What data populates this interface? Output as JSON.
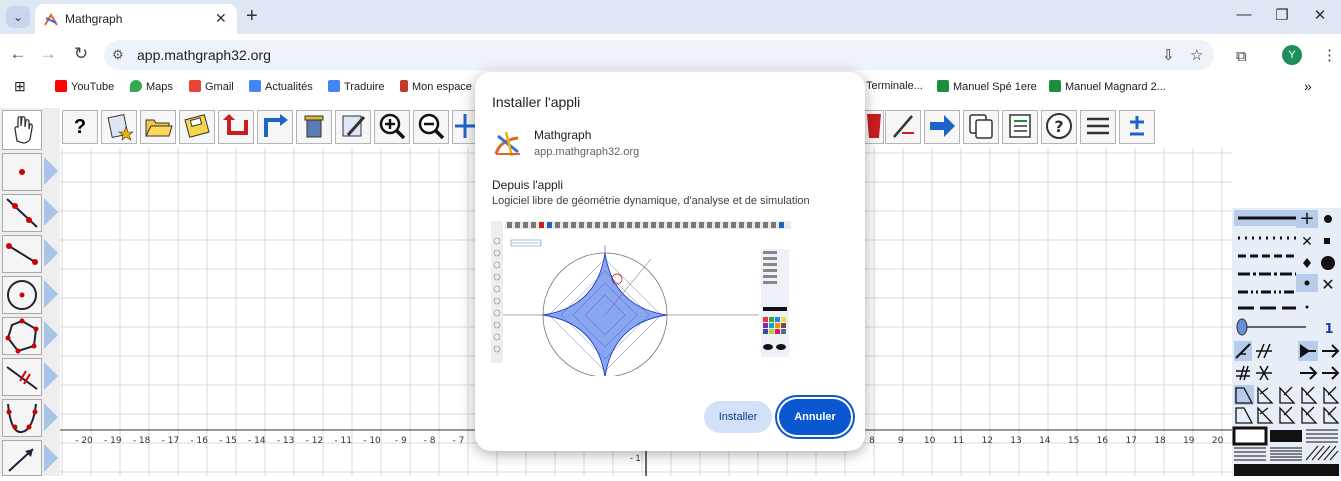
{
  "browser": {
    "tab_title": "Mathgraph",
    "tab_close": "✕",
    "new_tab": "+",
    "url": "app.mathgraph32.org",
    "profile_initial": "Y",
    "bookmarks": [
      {
        "label": "YouTube",
        "color": "#ff0000"
      },
      {
        "label": "Maps",
        "color": "#34a853"
      },
      {
        "label": "Gmail",
        "color": "#ea4335"
      },
      {
        "label": "Actualités",
        "color": "#4285f4"
      },
      {
        "label": "Traduire",
        "color": "#4285f4"
      },
      {
        "label": "Mon espace",
        "color": "#c0392b"
      },
      {
        "label": "Terminale...",
        "color": "#ffffff"
      },
      {
        "label": "Manuel Spé 1ere",
        "color": "#1e8e3e"
      },
      {
        "label": "Manuel Magnard 2...",
        "color": "#1e8e3e"
      }
    ],
    "bookmarks_overflow": "»"
  },
  "dialog": {
    "title": "Installer l'appli",
    "app_name": "Mathgraph",
    "app_url": "app.mathgraph32.org",
    "from_label": "Depuis l'appli",
    "description": "Logiciel libre de géométrie dynamique, d'analyse et de simulation",
    "install_label": "Installer",
    "cancel_label": "Annuler"
  },
  "app": {
    "help_icon_text": "?",
    "axis_labels": [
      "- 20",
      "- 19",
      "- 18",
      "- 17",
      "- 16",
      "- 15",
      "- 14",
      "- 13",
      "- 12",
      "- 11",
      "- 10",
      "- 9",
      "- 8",
      "- 7",
      "8",
      "9",
      "10",
      "11",
      "12",
      "13",
      "14",
      "15",
      "16",
      "17",
      "18",
      "19",
      "20"
    ],
    "y_label": "- 1",
    "right_palette_value": "1"
  },
  "colors": {
    "accent": "#0b57d0",
    "install_bg": "#d3e1f8",
    "grid": "#d8d8d8",
    "palette_arrow": "#a8c4e8"
  }
}
